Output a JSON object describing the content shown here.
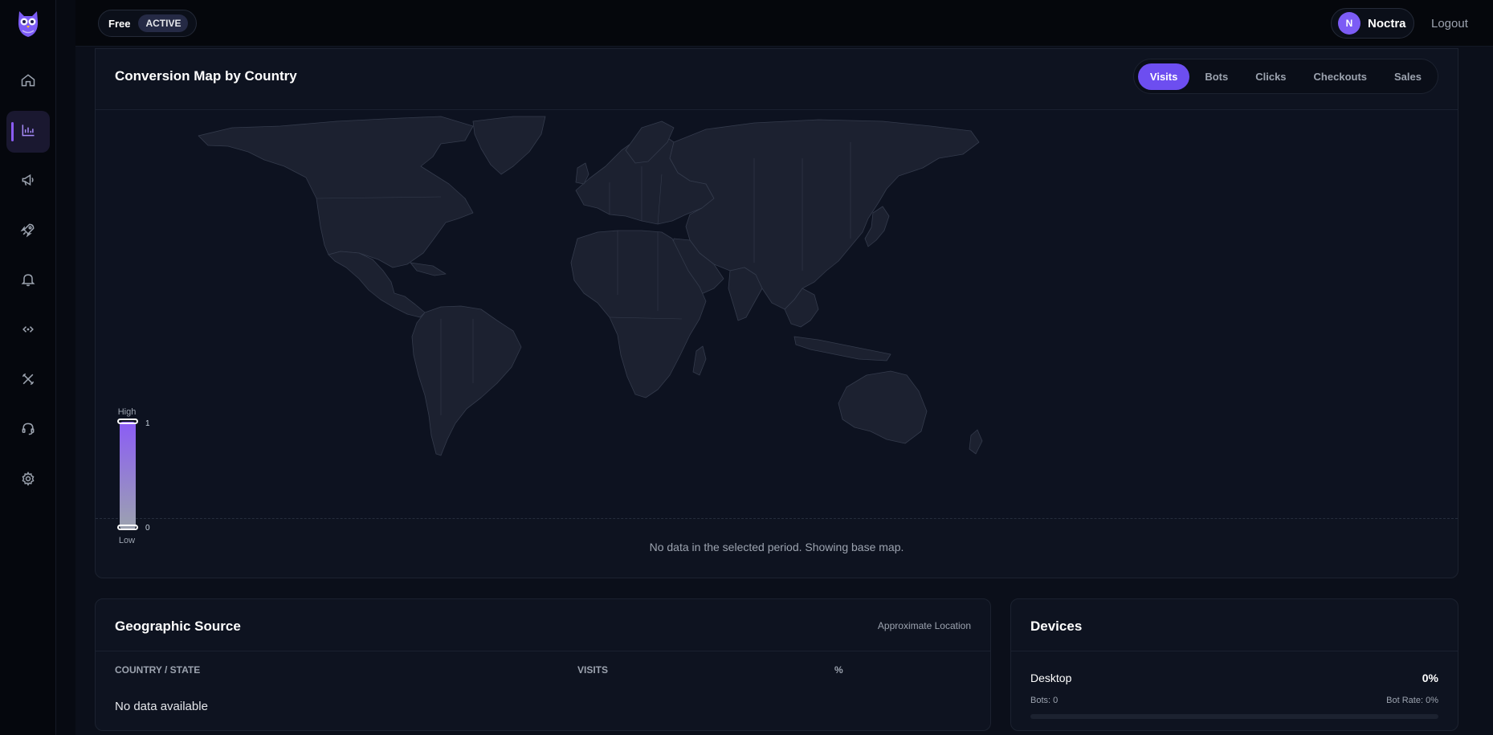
{
  "topbar": {
    "plan": "Free",
    "plan_status": "ACTIVE",
    "user_initial": "N",
    "user_name": "Noctra",
    "logout": "Logout"
  },
  "sidebar": {
    "items": [
      {
        "icon": "home-icon"
      },
      {
        "icon": "analytics-chart-icon",
        "active": true
      },
      {
        "icon": "megaphone-icon"
      },
      {
        "icon": "rocket-icon"
      },
      {
        "icon": "bell-icon"
      },
      {
        "icon": "code-icon"
      },
      {
        "icon": "tools-icon"
      },
      {
        "icon": "headset-icon"
      },
      {
        "icon": "gear-icon"
      }
    ]
  },
  "map_card": {
    "title": "Conversion Map by Country",
    "tabs": [
      "Visits",
      "Bots",
      "Clicks",
      "Checkouts",
      "Sales"
    ],
    "active_tab": "Visits",
    "legend": {
      "high": "High",
      "low": "Low",
      "max": "1",
      "min": "0"
    },
    "empty_message": "No data in the selected period. Showing base map."
  },
  "geo_card": {
    "title": "Geographic Source",
    "note": "Approximate Location",
    "columns": [
      "COUNTRY / STATE",
      "VISITS",
      "%"
    ],
    "empty": "No data available"
  },
  "devices_card": {
    "title": "Devices",
    "devices": [
      {
        "name": "Desktop",
        "percent": "0%",
        "bots": "Bots: 0",
        "bot_rate": "Bot Rate: 0%",
        "share": 0
      }
    ]
  },
  "colors": {
    "accent": "#6d4ef0",
    "background": "#0b0f1a",
    "card": "#0e1320"
  }
}
